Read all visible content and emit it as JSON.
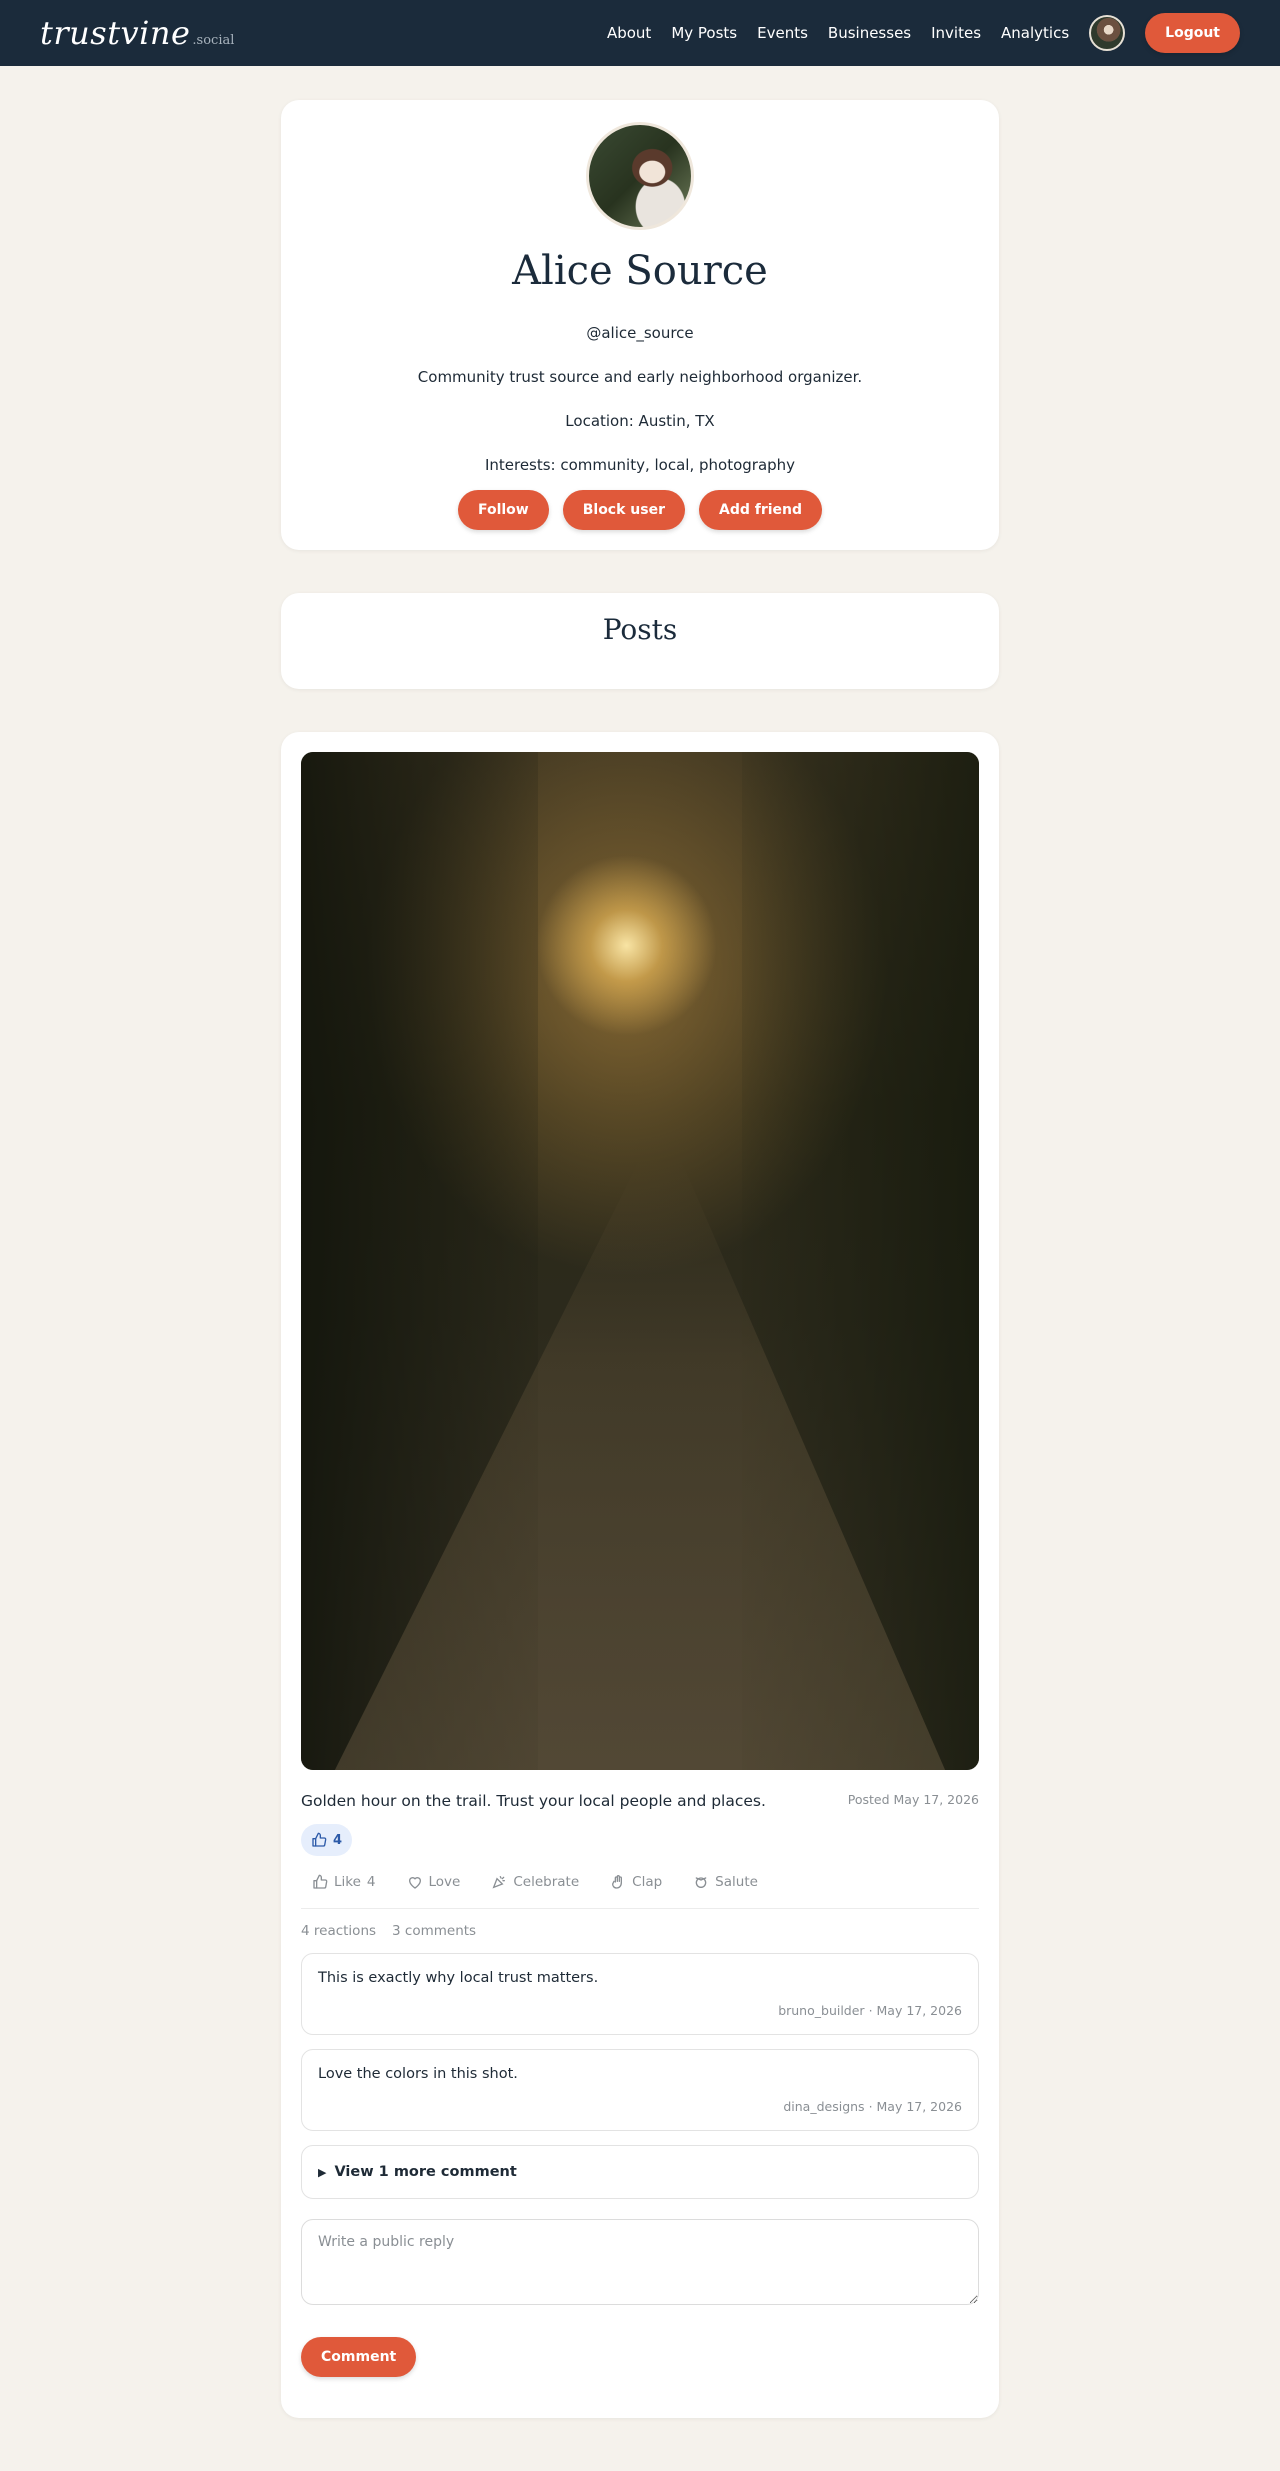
{
  "nav": {
    "brand": "trustvine",
    "brand_suffix": ".social",
    "links": [
      "About",
      "My Posts",
      "Events",
      "Businesses",
      "Invites",
      "Analytics"
    ],
    "logout": "Logout"
  },
  "profile": {
    "name": "Alice Source",
    "handle": "@alice_source",
    "bio": "Community trust source and early neighborhood organizer.",
    "location": "Location: Austin, TX",
    "interests": "Interests: community, local, photography",
    "actions": {
      "follow": "Follow",
      "block": "Block user",
      "add_friend": "Add friend"
    }
  },
  "posts_section": {
    "title": "Posts"
  },
  "post": {
    "caption": "Golden hour on the trail. Trust your local people and places.",
    "posted": "Posted May 17, 2026",
    "reaction_chip_count": "4",
    "reactions": [
      {
        "label": "Like",
        "count": "4",
        "icon": "thumbs-up-icon"
      },
      {
        "label": "Love",
        "count": "",
        "icon": "heart-icon"
      },
      {
        "label": "Celebrate",
        "count": "",
        "icon": "party-icon"
      },
      {
        "label": "Clap",
        "count": "",
        "icon": "clap-icon"
      },
      {
        "label": "Salute",
        "count": "",
        "icon": "salute-icon"
      }
    ],
    "reaction_total": "4 reactions",
    "comment_total": "3 comments",
    "comments": [
      {
        "text": "This is exactly why local trust matters.",
        "author": "bruno_builder",
        "date": "· May 17, 2026"
      },
      {
        "text": "Love the colors in this shot.",
        "author": "dina_designs",
        "date": "· May 17, 2026"
      }
    ],
    "more_comments": "View 1 more comment",
    "reply_placeholder": "Write a public reply",
    "comment_button": "Comment"
  },
  "colors": {
    "nav_bg": "#1b2b3b",
    "accent": "#e0593a",
    "page_bg": "#f5f2ec",
    "chip_bg": "#e6eefc"
  }
}
